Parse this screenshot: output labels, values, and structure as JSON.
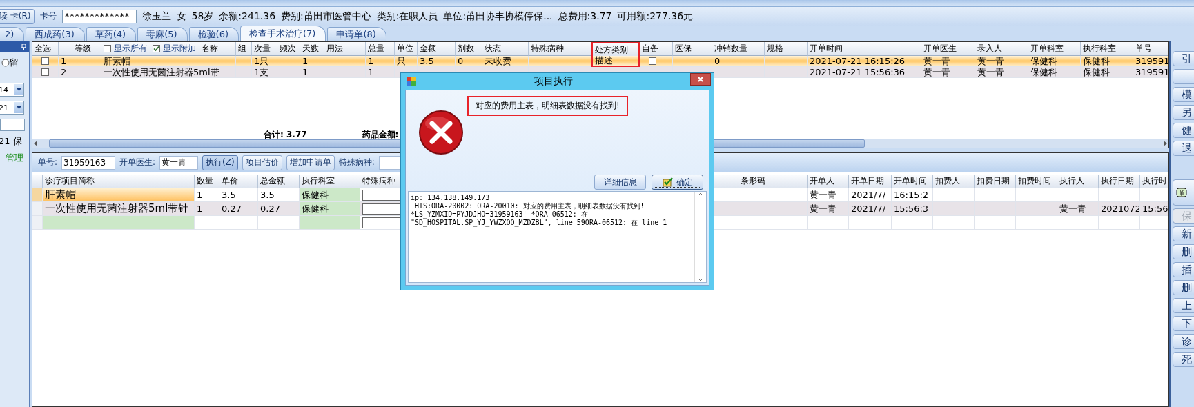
{
  "patient_bar": {
    "read_button": "读 卡(R)",
    "card_label": "卡号",
    "card_value": "*************",
    "info": [
      "徐玉兰",
      "女",
      "58岁",
      "余额:241.36",
      "费别:莆田市医管中心",
      "类别:在职人员",
      "单位:莆田协丰协模停保...",
      "总费用:3.77",
      "可用额:277.36元"
    ]
  },
  "tabs": [
    {
      "label": "2)",
      "selected": false
    },
    {
      "label": "西成药(3)",
      "selected": false
    },
    {
      "label": "草药(4)",
      "selected": false
    },
    {
      "label": "毒麻(5)",
      "selected": false
    },
    {
      "label": "检验(6)",
      "selected": false
    },
    {
      "label": "检查手术治疗(7)",
      "selected": true
    },
    {
      "label": "申请单(8)",
      "selected": false
    }
  ],
  "left_panel": {
    "radio_label": "留",
    "radio_selected": false,
    "dropdowns": [
      "14",
      "21"
    ],
    "lines": [
      {
        "text": "21 保",
        "kind": "plain"
      },
      {
        "text": "管理",
        "kind": "link"
      }
    ]
  },
  "upper_table": {
    "header_options": [
      {
        "label": "显示所有",
        "checked": false
      },
      {
        "label": "显示附加",
        "checked": true
      }
    ],
    "columns": [
      {
        "label": "全选"
      },
      {},
      {
        "label": "等级"
      },
      {
        "label": "名称"
      },
      {
        "label": "组"
      },
      {
        "label": "次量"
      },
      {
        "label": "频次"
      },
      {
        "label": "天数"
      },
      {
        "label": "用法"
      },
      {
        "label": "总量"
      },
      {
        "label": "单位"
      },
      {
        "label": "金额"
      },
      {
        "label": "剂数"
      },
      {
        "label": "状态"
      },
      {
        "label": "特殊病种"
      },
      {
        "label": "处方类别",
        "highlighted": true
      },
      {
        "label": "自备"
      },
      {
        "label": "医保"
      },
      {
        "label": "冲销数量"
      },
      {
        "label": "规格"
      },
      {
        "label": "开单时间"
      },
      {
        "label": "开单医生"
      },
      {
        "label": "录入人"
      },
      {
        "label": "开单科室"
      },
      {
        "label": "执行科室"
      },
      {
        "label": "单号"
      }
    ],
    "rows": [
      {
        "selected": true,
        "checked": false,
        "self_supplied": false,
        "cells": [
          null,
          "1",
          null,
          "肝素帽",
          null,
          "1只",
          null,
          "1",
          null,
          "1",
          "只",
          "3.5",
          "0",
          "未收费",
          null,
          "描述",
          null,
          null,
          "0",
          null,
          "2021-07-21 16:15:26",
          "黄一青",
          "黄一青",
          "保健科",
          "保健科",
          "319591"
        ]
      },
      {
        "selected": false,
        "checked": false,
        "cells": [
          null,
          "2",
          null,
          "一次性使用无菌注射器5ml带",
          null,
          "1支",
          null,
          "1",
          null,
          "1",
          null,
          null,
          null,
          null,
          null,
          null,
          null,
          null,
          null,
          null,
          "2021-07-21 15:56:36",
          "黄一青",
          "黄一青",
          "保健科",
          "保健科",
          "319591"
        ]
      }
    ],
    "summary": [
      "合计:  3.77",
      "药品金额:"
    ]
  },
  "lower_toolbar": {
    "order_label": "单号:",
    "order_value": "31959163",
    "doctor_label": "开单医生:",
    "doctor_value": "黄一青",
    "buttons": [
      {
        "label": "执行(Z)",
        "selected": true
      },
      {
        "label": "项目估价",
        "selected": false
      },
      {
        "label": "增加申请单",
        "selected": false
      }
    ],
    "special_label": "特殊病种:"
  },
  "lower_table": {
    "columns": [
      "诊疗项目简称",
      "数量",
      "单价",
      "总金额",
      "执行科室",
      "特殊病种",
      "条形码",
      "开单人",
      "开单日期",
      "开单时间",
      "扣费人",
      "扣费日期",
      "扣费时间",
      "执行人",
      "执行日期",
      "执行时"
    ],
    "rows": [
      {
        "selected": true,
        "cells": [
          "肝素帽",
          "1",
          "3.5",
          "3.5",
          "保健科",
          null,
          null,
          "黄一青",
          "2021/7/",
          "16:15:2",
          null,
          null,
          null,
          null,
          null,
          null
        ]
      },
      {
        "selected": false,
        "cells": [
          "一次性使用无菌注射器5ml带针",
          "1",
          "0.27",
          "0.27",
          "保健科",
          null,
          null,
          "黄一青",
          "2021/7/",
          "15:56:3",
          null,
          null,
          null,
          "黄一青",
          "2021072",
          "15:56"
        ]
      }
    ]
  },
  "side_buttons": [
    {
      "label": "引",
      "kind": "plain",
      "disabled": false
    },
    {
      "kind": "plain",
      "disabled": false
    },
    {
      "label": "模",
      "kind": "plain",
      "disabled": false
    },
    {
      "label": "另",
      "kind": "plain",
      "disabled": false
    },
    {
      "label": "健",
      "kind": "plain",
      "disabled": false
    },
    {
      "label": "退",
      "kind": "plain",
      "disabled": false
    },
    {
      "kind": "money",
      "disabled": false
    },
    {
      "label": "保",
      "kind": "plain",
      "disabled": true
    },
    {
      "label": "新",
      "kind": "plain",
      "disabled": false
    },
    {
      "label": "删",
      "kind": "plain",
      "disabled": false
    },
    {
      "label": "插",
      "kind": "plain",
      "disabled": false
    },
    {
      "label": "删",
      "kind": "plain",
      "disabled": false
    },
    {
      "label": "上",
      "kind": "plain",
      "disabled": false
    },
    {
      "label": "下",
      "kind": "plain",
      "disabled": false
    },
    {
      "label": "诊",
      "kind": "plain",
      "disabled": false
    },
    {
      "label": "死",
      "kind": "plain",
      "disabled": false
    }
  ],
  "dialog": {
    "title": "项目执行",
    "message": "对应的费用主表，明细表数据没有找到!",
    "buttons": [
      {
        "label": "详细信息",
        "kind": "plain"
      },
      {
        "label": "确定",
        "kind": "confirm"
      }
    ],
    "details": "ip: 134.138.149.173\n HIS:ORA-20002: ORA-20010: 对应的费用主表，明细表数据没有找到!\n*LS_YZMXID=PYJDJHO=31959163! *ORA-06512: 在\n\"SD_HOSPITAL.SP_YJ_YWZXOO_MZDZBL\", line 59ORA-06512: 在 line 1"
  }
}
